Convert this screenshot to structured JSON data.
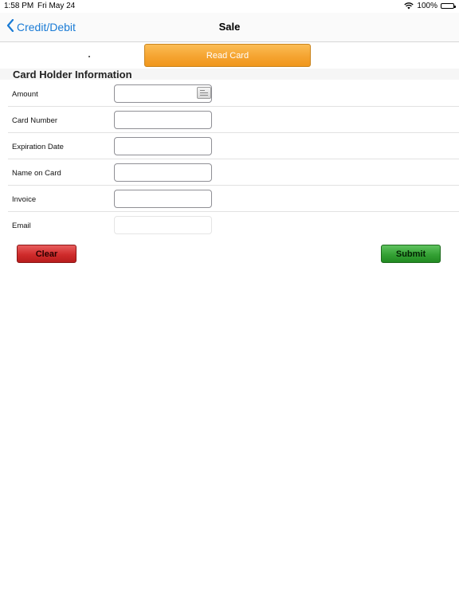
{
  "status_bar": {
    "time": "1:58 PM",
    "date": "Fri May 24",
    "battery": "100%"
  },
  "nav": {
    "back_label": "Credit/Debit",
    "title": "Sale"
  },
  "read_card_label": "Read Card",
  "section_title": "Card Holder Information",
  "fields": [
    {
      "label": "Amount",
      "value": "",
      "icon": "calculator-icon"
    },
    {
      "label": "Card Number",
      "value": ""
    },
    {
      "label": "Expiration Date",
      "value": ""
    },
    {
      "label": "Name on Card",
      "value": ""
    },
    {
      "label": "Invoice",
      "value": ""
    },
    {
      "label": "Email",
      "value": ""
    }
  ],
  "buttons": {
    "clear_label": "Clear",
    "submit_label": "Submit"
  },
  "colors": {
    "accent": "#1a7bd5",
    "read_card": "#f5a431",
    "clear": "#cf2b2b",
    "submit": "#34a134"
  }
}
